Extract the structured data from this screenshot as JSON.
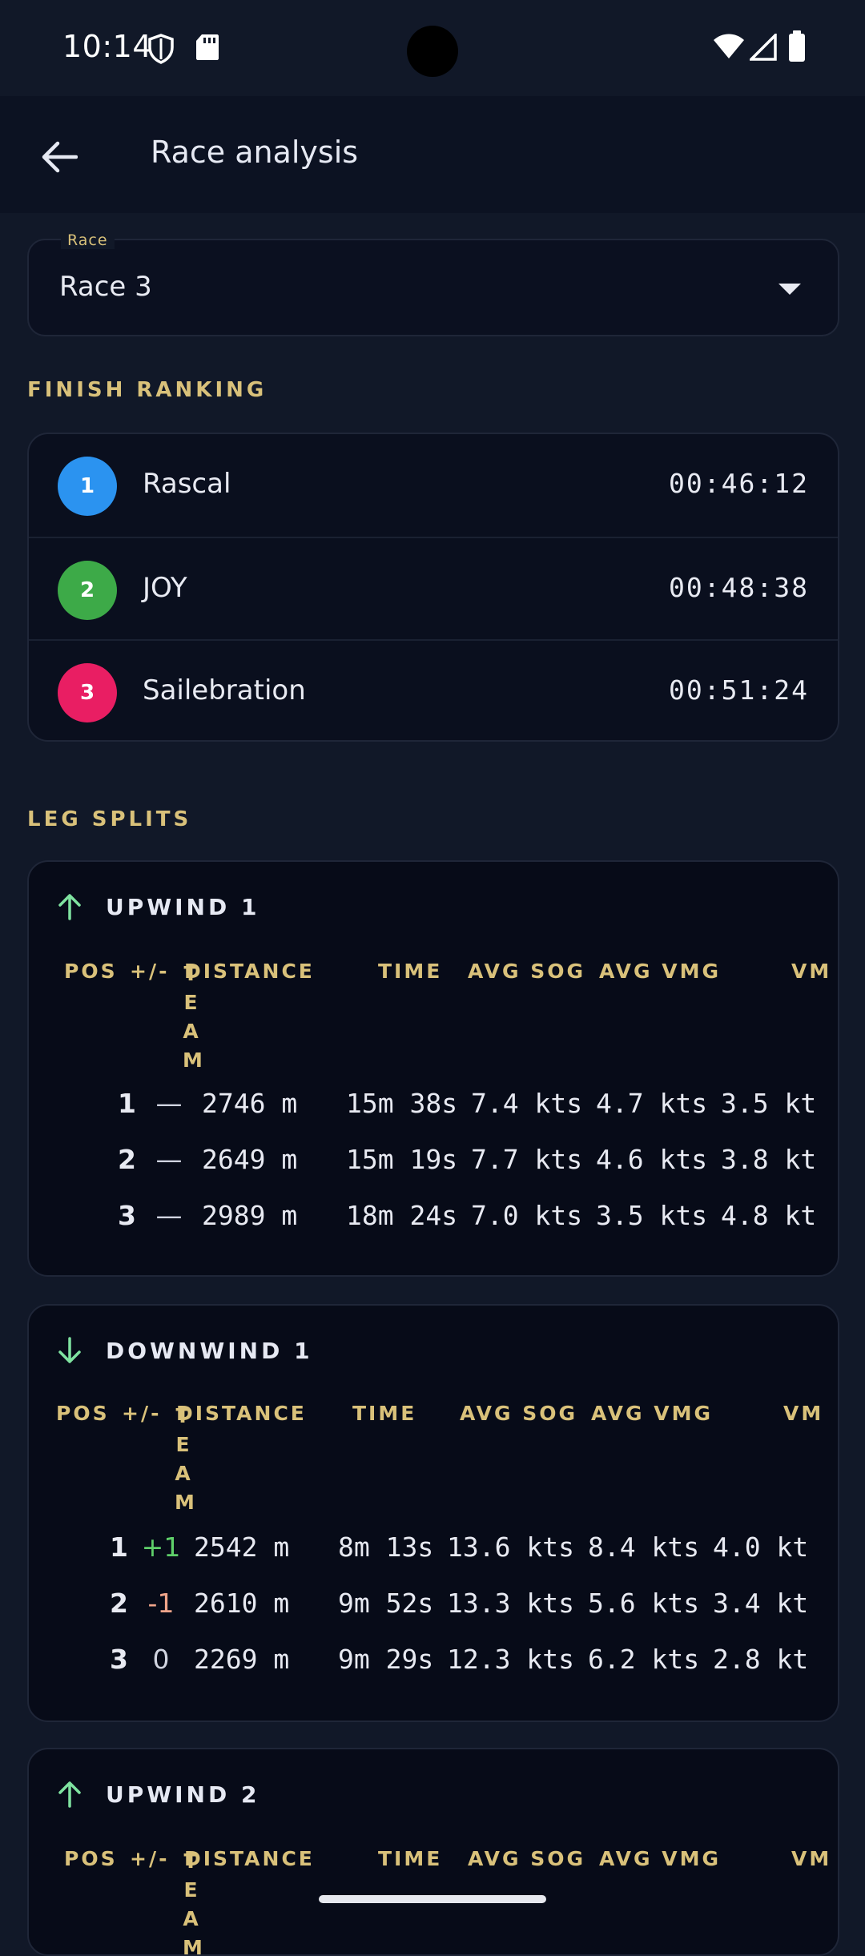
{
  "status_bar": {
    "time": "10:14"
  },
  "app_bar": {
    "title": "Race analysis"
  },
  "race_select": {
    "label": "Race",
    "value": "Race 3"
  },
  "finish_ranking": {
    "heading": "FINISH RANKING",
    "rows": [
      {
        "position": "1",
        "name": "Rascal",
        "time": "00:46:12",
        "color": "#2b93f0"
      },
      {
        "position": "2",
        "name": "JOY",
        "time": "00:48:38",
        "color": "#3daa48"
      },
      {
        "position": "3",
        "name": "Sailebration",
        "time": "00:51:24",
        "color": "#e91e63"
      }
    ]
  },
  "leg_splits": {
    "heading": "LEG SPLITS",
    "columns": {
      "pos": "POS",
      "delta": "+/-",
      "team": "TEAM",
      "distance": "DISTANCE",
      "time": "TIME",
      "avg_sog": "AVG SOG",
      "avg_vmg": "AVG VMG",
      "vmg_partial": "VM"
    },
    "legs": [
      {
        "title": "UPWIND 1",
        "direction": "up",
        "rows": [
          {
            "pos": "1",
            "delta": "—",
            "delta_kind": "none",
            "distance": "2746 m",
            "time": "15m 38s",
            "avg_sog": "7.4 kts",
            "avg_vmg": "4.7 kts",
            "extra": "3.5 kt"
          },
          {
            "pos": "2",
            "delta": "—",
            "delta_kind": "none",
            "distance": "2649 m",
            "time": "15m 19s",
            "avg_sog": "7.7 kts",
            "avg_vmg": "4.6 kts",
            "extra": "3.8 kt"
          },
          {
            "pos": "3",
            "delta": "—",
            "delta_kind": "none",
            "distance": "2989 m",
            "time": "18m 24s",
            "avg_sog": "7.0 kts",
            "avg_vmg": "3.5 kts",
            "extra": "4.8 kt"
          }
        ]
      },
      {
        "title": "DOWNWIND 1",
        "direction": "down",
        "rows": [
          {
            "pos": "1",
            "delta": "+1",
            "delta_kind": "pos",
            "distance": "2542 m",
            "time": "8m 13s",
            "avg_sog": "13.6 kts",
            "avg_vmg": "8.4 kts",
            "extra": "4.0 kt"
          },
          {
            "pos": "2",
            "delta": "-1",
            "delta_kind": "neg",
            "distance": "2610 m",
            "time": "9m 52s",
            "avg_sog": "13.3 kts",
            "avg_vmg": "5.6 kts",
            "extra": "3.4 kt"
          },
          {
            "pos": "3",
            "delta": "0",
            "delta_kind": "none",
            "distance": "2269 m",
            "time": "9m 29s",
            "avg_sog": "12.3 kts",
            "avg_vmg": "6.2 kts",
            "extra": "2.8 kt"
          }
        ]
      },
      {
        "title": "UPWIND 2",
        "direction": "up",
        "rows": []
      }
    ]
  },
  "colors": {
    "background": "#111828",
    "accent_gold": "#d9c17a",
    "arrow_green": "#7fe3a0",
    "delta_positive": "#5fd06a",
    "delta_negative": "#f0a58b"
  }
}
